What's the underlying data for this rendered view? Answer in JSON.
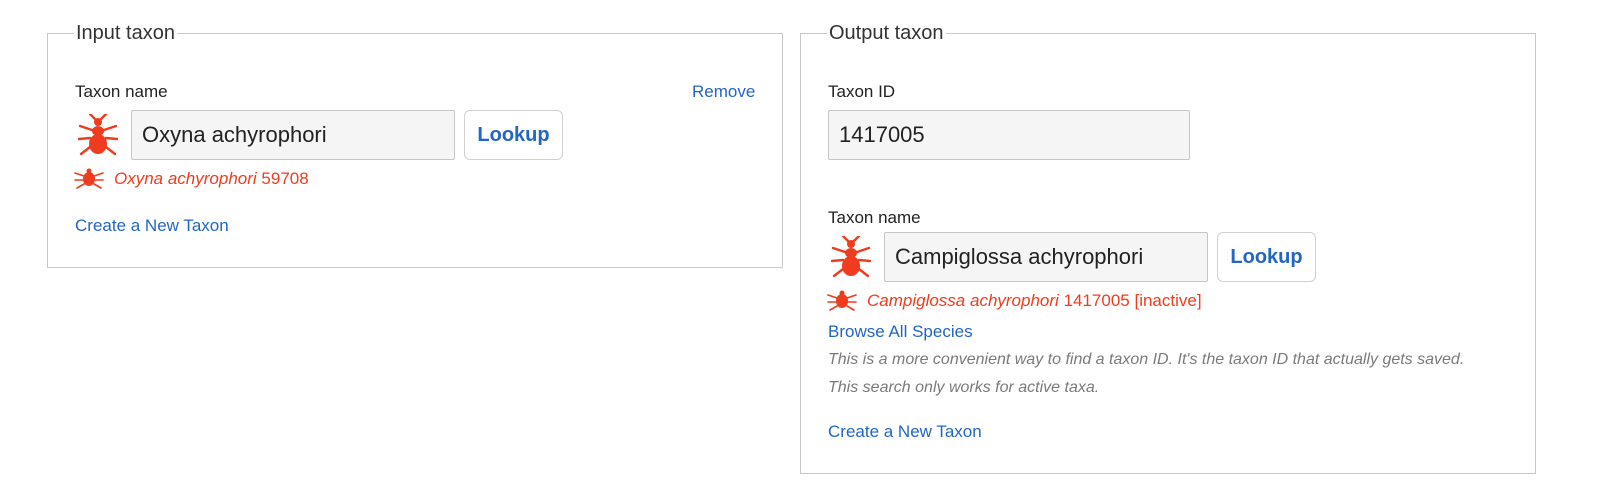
{
  "colors": {
    "accent_link": "#2266c4",
    "taxon_icon": "#f03c1e",
    "panel_border": "#c8c8c8"
  },
  "input_taxon": {
    "legend": "Input taxon",
    "taxon_name_label": "Taxon name",
    "remove_link": "Remove",
    "taxon_icon": "insect-icon",
    "taxon_name_value": "Oxyna achyrophori",
    "lookup_button": "Lookup",
    "result": {
      "icon": "insect-icon",
      "scientific_name": "Oxyna achyrophori",
      "id": "59708"
    },
    "create_link": "Create a New Taxon"
  },
  "output_taxon": {
    "legend": "Output taxon",
    "taxon_id_label": "Taxon ID",
    "taxon_id_value": "1417005",
    "taxon_name_label": "Taxon name",
    "taxon_icon": "insect-icon",
    "taxon_name_value": "Campiglossa achyrophori",
    "lookup_button": "Lookup",
    "result": {
      "icon": "insect-icon",
      "scientific_name": "Campiglossa achyrophori",
      "id_status": "1417005 [inactive]"
    },
    "browse_link": "Browse All Species",
    "hint": "This is a more convenient way to find a taxon ID. It's the taxon ID that actually gets saved. This search only works for active taxa.",
    "create_link": "Create a New Taxon"
  }
}
